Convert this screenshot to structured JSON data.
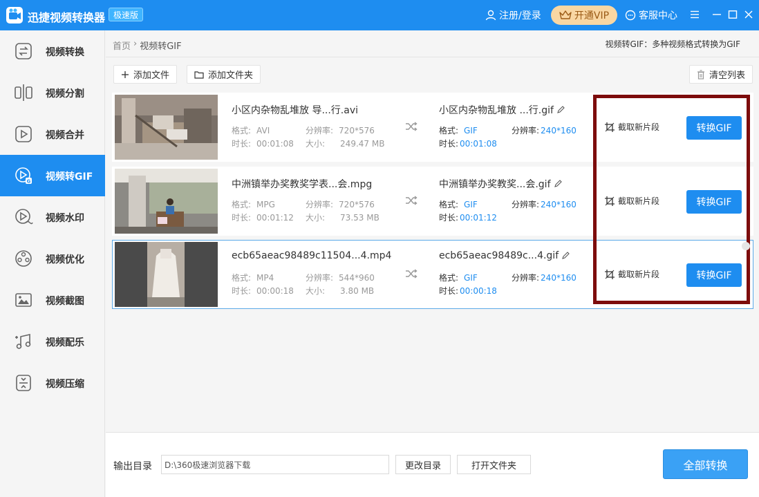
{
  "app": {
    "title": "迅捷视频转换器",
    "badge": "极速版",
    "login": "注册/登录",
    "vip": "开通VIP",
    "service": "客服中心"
  },
  "sidebar": {
    "items": [
      {
        "label": "视频转换",
        "icon": "video-convert-icon"
      },
      {
        "label": "视频分割",
        "icon": "video-split-icon"
      },
      {
        "label": "视频合并",
        "icon": "video-merge-icon"
      },
      {
        "label": "视频转GIF",
        "icon": "video-gif-icon",
        "active": true
      },
      {
        "label": "视频水印",
        "icon": "video-watermark-icon"
      },
      {
        "label": "视频优化",
        "icon": "video-optimize-icon"
      },
      {
        "label": "视频截图",
        "icon": "video-screenshot-icon"
      },
      {
        "label": "视频配乐",
        "icon": "video-music-icon"
      },
      {
        "label": "视频压缩",
        "icon": "video-compress-icon"
      }
    ]
  },
  "breadcrumb": {
    "home": "首页",
    "sep": "›",
    "current": "视频转GIF"
  },
  "header_desc": "视频转GIF：多种视频格式转换为GIF",
  "toolbar": {
    "add_file": "添加文件",
    "add_folder": "添加文件夹",
    "clear_list": "清空列表"
  },
  "labels": {
    "format": "格式:",
    "resolution": "分辨率:",
    "duration": "时长:",
    "size": "大小:",
    "crop": "截取新片段",
    "convert": "转换GIF"
  },
  "files": [
    {
      "name": "小区内杂物乱堆放 导...行.avi",
      "format": "AVI",
      "resolution": "720*576",
      "duration": "00:01:08",
      "size": "249.47 MB",
      "out_name": "小区内杂物乱堆放 ...行.gif",
      "out_format": "GIF",
      "out_resolution": "240*160",
      "out_duration": "00:01:08"
    },
    {
      "name": "中洲镇举办奖教奖学表...会.mpg",
      "format": "MPG",
      "resolution": "720*576",
      "duration": "00:01:12",
      "size": "73.53 MB",
      "out_name": "中洲镇举办奖教奖...会.gif",
      "out_format": "GIF",
      "out_resolution": "240*160",
      "out_duration": "00:01:12"
    },
    {
      "name": "ecb65aeac98489c11504...4.mp4",
      "format": "MP4",
      "resolution": "544*960",
      "duration": "00:00:18",
      "size": "3.80 MB",
      "out_name": "ecb65aeac98489c...4.gif",
      "out_format": "GIF",
      "out_resolution": "240*160",
      "out_duration": "00:00:18"
    }
  ],
  "bottom": {
    "output_label": "输出目录",
    "output_path": "D:\\360极速浏览器下载",
    "change_dir": "更改目录",
    "open_folder": "打开文件夹",
    "convert_all": "全部转换"
  },
  "colors": {
    "brand": "#1e8df0",
    "highlight": "#7d0c0c",
    "vip": "#f9d7a3"
  }
}
